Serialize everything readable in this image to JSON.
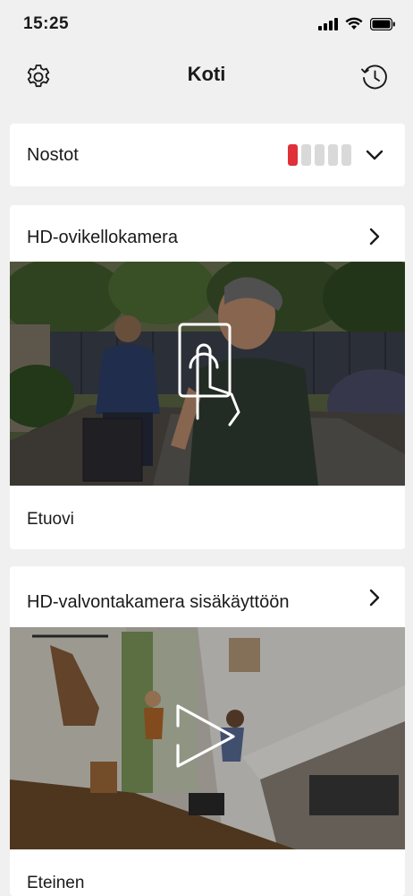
{
  "status": {
    "time": "15:25"
  },
  "nav": {
    "title": "Koti"
  },
  "alarm": {
    "label": "Nostot",
    "level": 1,
    "max": 5,
    "active_color": "#e0303a",
    "inactive_color": "#d9d9d9"
  },
  "cameras": [
    {
      "title": "HD-ovikellokamera",
      "caption": "Etuovi",
      "overlay_icon": "doorbell-press-icon"
    },
    {
      "title": "HD-valvontakamera sisäkäyttöön",
      "caption": "Eteinen",
      "overlay_icon": "play-icon"
    }
  ]
}
